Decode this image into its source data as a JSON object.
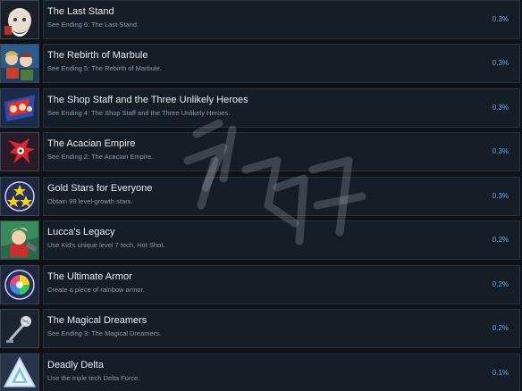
{
  "achievements": [
    {
      "title": "The Last Stand",
      "description": "See Ending 6: The Last Stand.",
      "percent": "0.3%",
      "icon": "old-man-portrait-icon"
    },
    {
      "title": "The Rebirth of Marbule",
      "description": "See Ending 5: The Rebirth of Marbule.",
      "percent": "0.3%",
      "icon": "hero-group-portrait-icon"
    },
    {
      "title": "The Shop Staff and the Three Unlikely Heroes",
      "description": "See Ending 4: The Shop Staff and the Three Unlikely Heroes.",
      "percent": "0.3%",
      "icon": "shop-staff-icon"
    },
    {
      "title": "The Acacian Empire",
      "description": "See Ending 2: The Acacian Empire.",
      "percent": "0.3%",
      "icon": "red-creature-icon"
    },
    {
      "title": "Gold Stars for Everyone",
      "description": "Obtain 99 level-growth stars.",
      "percent": "0.3%",
      "icon": "gold-stars-icon"
    },
    {
      "title": "Lucca's Legacy",
      "description": "Use Kid's unique level 7 tech, Hot Shot.",
      "percent": "0.2%",
      "icon": "kid-portrait-icon"
    },
    {
      "title": "The Ultimate Armor",
      "description": "Create a piece of rainbow armor.",
      "percent": "0.2%",
      "icon": "rainbow-orb-icon"
    },
    {
      "title": "The Magical Dreamers",
      "description": "See Ending 3: The Magical Dreamers.",
      "percent": "0.2%",
      "icon": "microphone-icon"
    },
    {
      "title": "Deadly Delta",
      "description": "Use the triple tech Delta Force.",
      "percent": "0.1%",
      "icon": "delta-triangle-icon"
    }
  ]
}
